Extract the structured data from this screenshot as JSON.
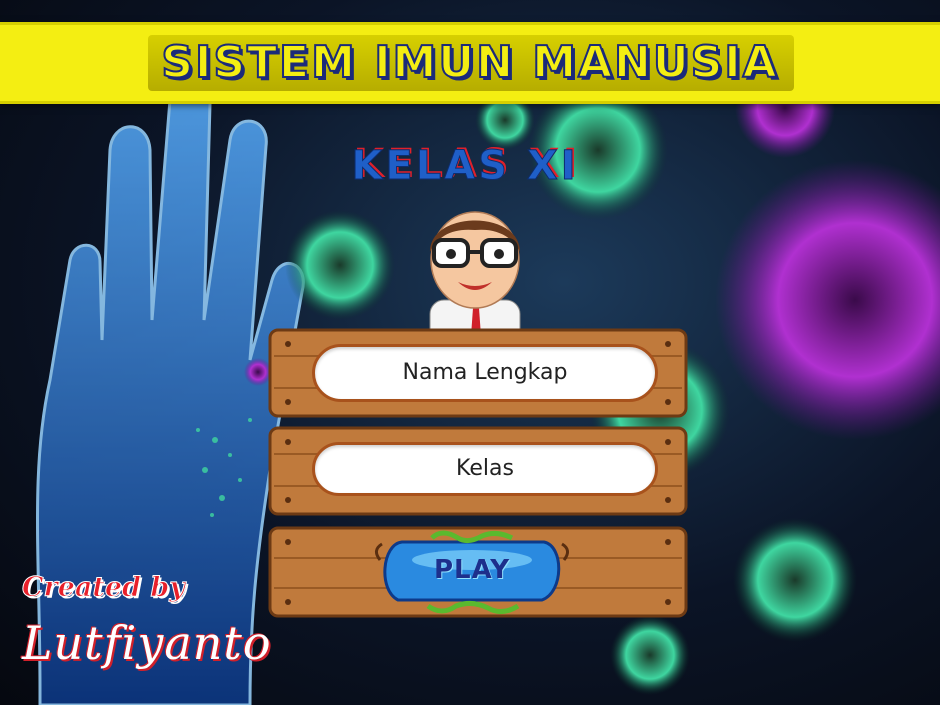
{
  "app": {
    "title": "SISTEM IMUN MANUSIA",
    "subtitle": "KELAS XI"
  },
  "form": {
    "name_placeholder": "Nama Lengkap",
    "class_placeholder": "Kelas"
  },
  "play_button": {
    "label": "PLAY"
  },
  "credits": {
    "line1": "Created by",
    "line2": "Lutfiyanto"
  },
  "colors": {
    "title_bar": "#f4ee12",
    "title_text_outline": "#1b2a7a",
    "wood": "#c07a3c",
    "play_button": "#2a8ae0",
    "credit_red": "#e8202a"
  }
}
